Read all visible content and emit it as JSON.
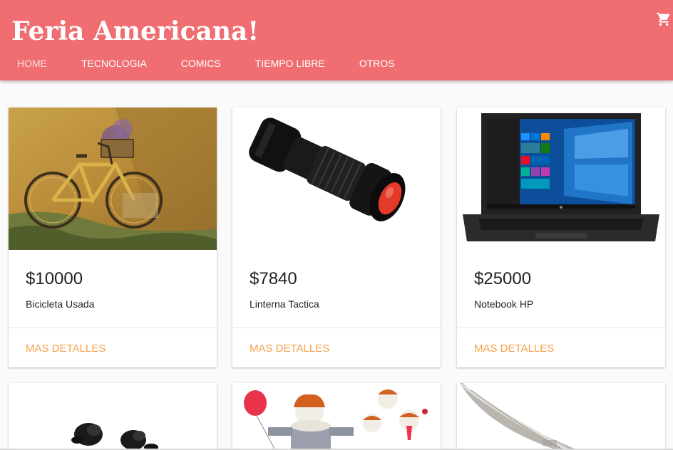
{
  "colors": {
    "header_bg": "#f06e72",
    "accent": "#f5a14b"
  },
  "header": {
    "brand": "Feria Americana!",
    "cart_icon": "shopping-cart-icon"
  },
  "nav": {
    "items": [
      {
        "label": "HOME"
      },
      {
        "label": "TECNOLOGIA"
      },
      {
        "label": "COMICS"
      },
      {
        "label": "TIEMPO LIBRE"
      },
      {
        "label": "OTROS"
      }
    ]
  },
  "products": [
    {
      "price": "$10000",
      "title": "Bicicleta Usada",
      "image": "bicycle-image",
      "action": "MAS DETALLES"
    },
    {
      "price": "$7840",
      "title": "Linterna Tactica",
      "image": "flashlight-image",
      "action": "MAS DETALLES"
    },
    {
      "price": "$25000",
      "title": "Notebook HP",
      "image": "laptop-image",
      "action": "MAS DETALLES"
    },
    {
      "image": "earbuds-image"
    },
    {
      "image": "clown-figure-image"
    },
    {
      "image": "knife-image"
    }
  ]
}
